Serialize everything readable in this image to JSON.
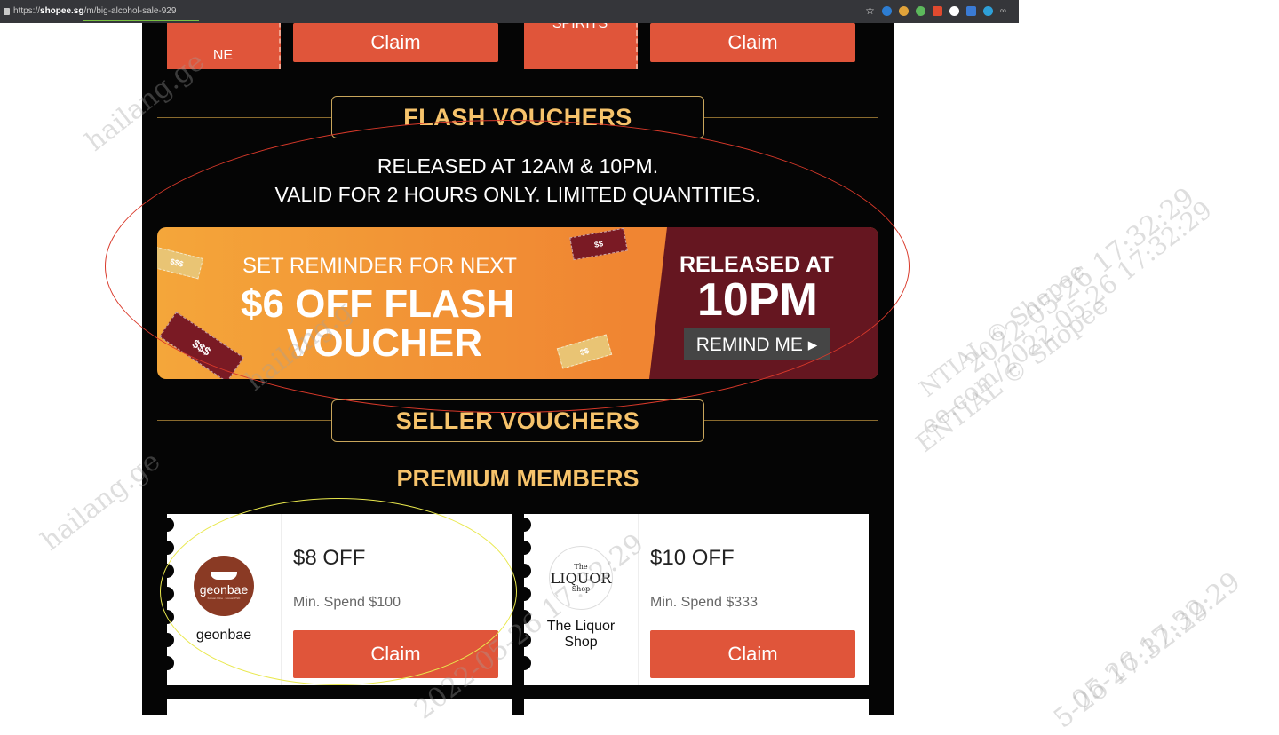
{
  "browser": {
    "url_scheme": "https://",
    "url_host": "shopee.sg",
    "url_path": "/m/big-alcohol-sale-929",
    "extension_icons": [
      "star-icon",
      "react-icon",
      "cookie-icon",
      "target-icon",
      "pen-icon",
      "compass-icon",
      "grid-icon",
      "m-icon",
      "infinity-icon"
    ]
  },
  "top_vouchers": [
    {
      "stub_label": "NE",
      "button_label": "Claim"
    },
    {
      "stub_label": "SPIRITS",
      "button_label": "Claim"
    }
  ],
  "flash_section": {
    "title": "FLASH VOUCHERS",
    "line1": "RELEASED AT 12AM & 10PM.",
    "line2": "VALID FOR 2 HOURS ONLY. LIMITED QUANTITIES."
  },
  "banner": {
    "reminder_text": "SET REMINDER FOR NEXT",
    "headline_1": "$6 OFF FLASH",
    "headline_2": "VOUCHER",
    "released_at_label": "RELEASED AT",
    "released_time": "10PM",
    "remind_button": "REMIND ME ▸",
    "ticket_labels": [
      "$$$",
      "$$",
      "$$$",
      "$$"
    ],
    "colors": {
      "orange": "#f08532",
      "maroon": "#651620"
    }
  },
  "seller_section": {
    "title": "SELLER VOUCHERS",
    "subtitle": "PREMIUM MEMBERS"
  },
  "seller_vouchers": [
    {
      "seller_name": "geonbae",
      "logo_text": "geonbae",
      "logo_tagline": "Korean Wine · Korean PSD",
      "discount": "$8 OFF",
      "min_spend": "Min. Spend $100",
      "button_label": "Claim"
    },
    {
      "seller_name": "The Liquor Shop",
      "logo_top": "The",
      "logo_main": "LIQUOR",
      "logo_bottom": "Shop",
      "discount": "$10 OFF",
      "min_spend": "Min. Spend $333",
      "button_label": "Claim"
    }
  ],
  "watermarks": [
    "hailang.ge",
    "hailang.ge",
    "2022-05-26 17:32:29",
    "ee.com/2022-05-26 17:32:29",
    "ENTIAL © Shopee",
    "hailang.g",
    "2022-05-26 17:32:29",
    "5-26 17:32:29",
    "05-26 17:32:29",
    "NTIAL © Shopee"
  ],
  "accent_colors": {
    "claim_button": "#e0553a",
    "gold": "#f6c36b",
    "page_background": "#050505"
  }
}
